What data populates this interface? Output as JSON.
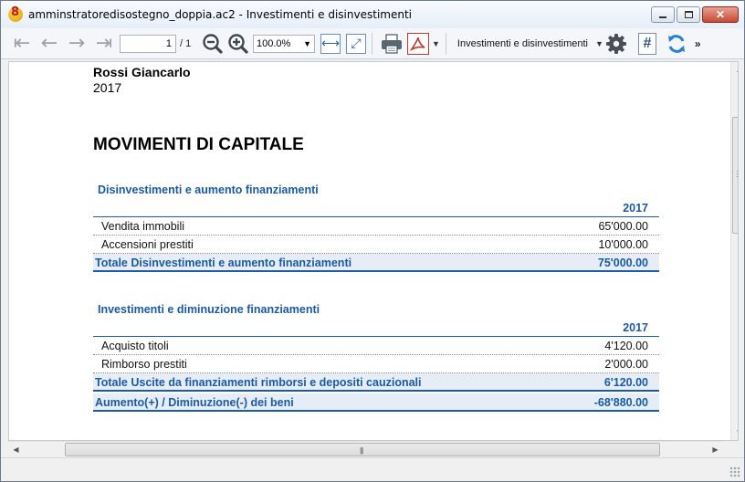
{
  "window": {
    "title": "amminstratoredisostegno_doppia.ac2 - Investimenti e disinvestimenti",
    "app_icon": "banana-accounting-icon"
  },
  "toolbar": {
    "page_current": "1",
    "page_total": "/ 1",
    "zoom": "100.0%",
    "view_name": "Investimenti e disinvestimenti",
    "more_label": "»",
    "colors": {
      "accent_blue": "#2b62b8",
      "pdf_red": "#c0392b",
      "gear_gray": "#4a4f55",
      "refresh_blue": "#2a7fd0"
    }
  },
  "report": {
    "owner": "Rossi Giancarlo",
    "year": "2017",
    "heading": "MOVIMENTI DI CAPITALE",
    "colors": {
      "section_blue": "#1a5aa6",
      "total_bg": "#e6edf6"
    },
    "sections": [
      {
        "title": "Disinvestimenti e aumento finanziamenti",
        "column_header": "2017",
        "rows": [
          {
            "label": "Vendita immobili",
            "value": "65'000.00"
          },
          {
            "label": "Accensioni prestiti",
            "value": "10'000.00"
          }
        ],
        "total": {
          "label": "Totale Disinvestimenti e aumento finanziamenti",
          "value": "75'000.00"
        }
      },
      {
        "title": "Investimenti e diminuzione finanziamenti",
        "column_header": "2017",
        "rows": [
          {
            "label": "Acquisto titoli",
            "value": "4'120.00"
          },
          {
            "label": "Rimborso prestiti",
            "value": "2'000.00"
          }
        ],
        "total": {
          "label": "Totale Uscite da finanziamenti rimborsi e depositi cauzionali",
          "value": "6'120.00"
        },
        "grand_total": {
          "label": "Aumento(+) / Diminuzione(-) dei beni",
          "value": "-68'880.00"
        }
      }
    ]
  }
}
